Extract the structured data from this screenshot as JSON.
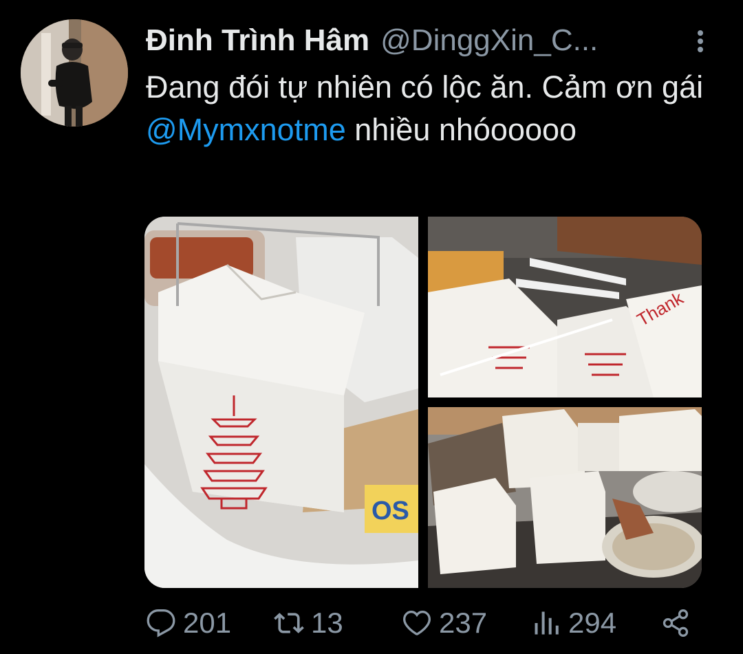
{
  "tweet": {
    "display_name": "Đinh Trình Hâm",
    "handle": "@DinggXin_C...",
    "text_part1": "Đang đói tự nhiên có lộc ăn. Cảm ơn gái ",
    "mention": "@Mymxnotme",
    "text_part2": " nhiều nhóooooo"
  },
  "actions": {
    "replies": "201",
    "retweets": "13",
    "likes": "237",
    "views": "294"
  },
  "icons": {
    "more": "more-vertical-icon",
    "reply": "reply-icon",
    "retweet": "retweet-icon",
    "like": "heart-icon",
    "views": "views-chart-icon",
    "share": "share-icon"
  },
  "colors": {
    "background": "#000000",
    "text": "#e7e9ea",
    "muted": "#8b98a5",
    "link": "#1d9bf0"
  }
}
